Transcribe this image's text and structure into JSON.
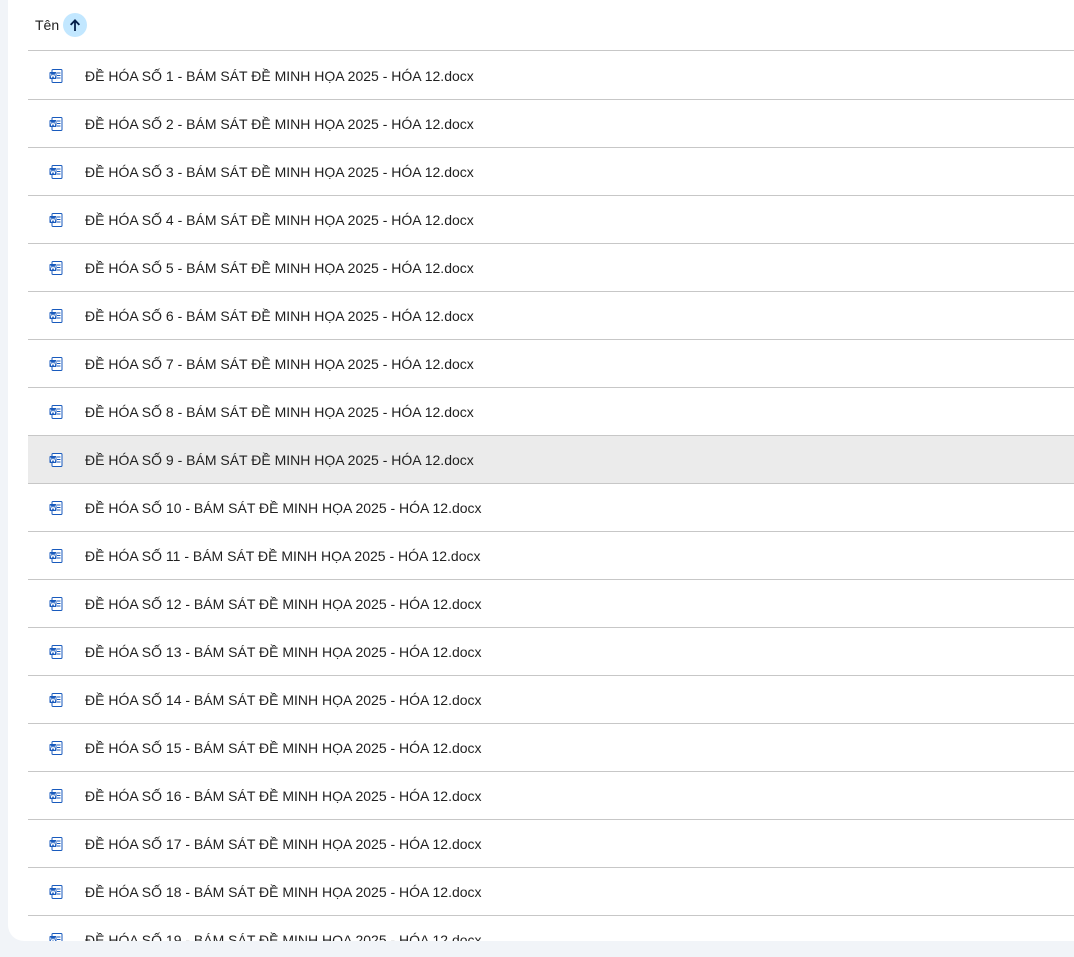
{
  "header": {
    "name_label": "Tên",
    "sort_direction": "ascending"
  },
  "colors": {
    "word_blue": "#185abd",
    "sort_chip": "#c2e7ff",
    "selected_row": "#ebebeb",
    "divider": "#c7c7c7"
  },
  "selected_index": 8,
  "files": [
    {
      "name": "ĐỀ HÓA SỐ 1 - BÁM SÁT ĐỀ MINH HỌA 2025 - HÓA 12.docx",
      "icon": "word-doc-icon"
    },
    {
      "name": "ĐỀ HÓA SỐ 2 - BÁM SÁT ĐỀ MINH HỌA 2025 - HÓA 12.docx",
      "icon": "word-doc-icon"
    },
    {
      "name": "ĐỀ HÓA SỐ 3 - BÁM SÁT ĐỀ MINH HỌA 2025 - HÓA 12.docx",
      "icon": "word-doc-icon"
    },
    {
      "name": "ĐỀ HÓA SỐ 4 - BÁM SÁT ĐỀ MINH HỌA 2025 - HÓA 12.docx",
      "icon": "word-doc-icon"
    },
    {
      "name": "ĐỀ HÓA SỐ 5 - BÁM SÁT ĐỀ MINH HỌA 2025 - HÓA 12.docx",
      "icon": "word-doc-icon"
    },
    {
      "name": "ĐỀ HÓA SỐ 6 - BÁM SÁT ĐỀ MINH HỌA 2025 - HÓA 12.docx",
      "icon": "word-doc-icon"
    },
    {
      "name": "ĐỀ HÓA SỐ 7 - BÁM SÁT ĐỀ MINH HỌA 2025 - HÓA 12.docx",
      "icon": "word-doc-icon"
    },
    {
      "name": "ĐỀ HÓA SỐ 8 - BÁM SÁT ĐỀ MINH HỌA 2025 - HÓA 12.docx",
      "icon": "word-doc-icon"
    },
    {
      "name": "ĐỀ HÓA SỐ 9 - BÁM SÁT ĐỀ MINH HỌA 2025 - HÓA 12.docx",
      "icon": "word-doc-icon"
    },
    {
      "name": "ĐỀ HÓA SỐ 10 - BÁM SÁT ĐỀ MINH HỌA 2025 - HÓA 12.docx",
      "icon": "word-doc-icon"
    },
    {
      "name": "ĐỀ HÓA SỐ 11 - BÁM SÁT ĐỀ MINH HỌA 2025 - HÓA 12.docx",
      "icon": "word-doc-icon"
    },
    {
      "name": "ĐỀ HÓA SỐ 12 - BÁM SÁT ĐỀ MINH HỌA 2025 - HÓA 12.docx",
      "icon": "word-doc-icon"
    },
    {
      "name": "ĐỀ HÓA SỐ 13 - BÁM SÁT ĐỀ MINH HỌA 2025 - HÓA 12.docx",
      "icon": "word-doc-icon"
    },
    {
      "name": "ĐỀ HÓA SỐ 14 - BÁM SÁT ĐỀ MINH HỌA 2025 - HÓA 12.docx",
      "icon": "word-doc-icon"
    },
    {
      "name": "ĐỀ HÓA SỐ 15 - BÁM SÁT ĐỀ MINH HỌA 2025 - HÓA 12.docx",
      "icon": "word-doc-icon"
    },
    {
      "name": "ĐỀ HÓA SỐ 16 - BÁM SÁT ĐỀ MINH HỌA 2025 - HÓA 12.docx",
      "icon": "word-doc-icon"
    },
    {
      "name": "ĐỀ HÓA SỐ 17 - BÁM SÁT ĐỀ MINH HỌA 2025 - HÓA 12.docx",
      "icon": "word-doc-icon"
    },
    {
      "name": "ĐỀ HÓA SỐ 18 - BÁM SÁT ĐỀ MINH HỌA 2025 - HÓA 12.docx",
      "icon": "word-doc-icon"
    },
    {
      "name": "ĐỀ HÓA SỐ 19 - BÁM SÁT ĐỀ MINH HỌA 2025 - HÓA 12.docx",
      "icon": "word-doc-icon"
    }
  ]
}
